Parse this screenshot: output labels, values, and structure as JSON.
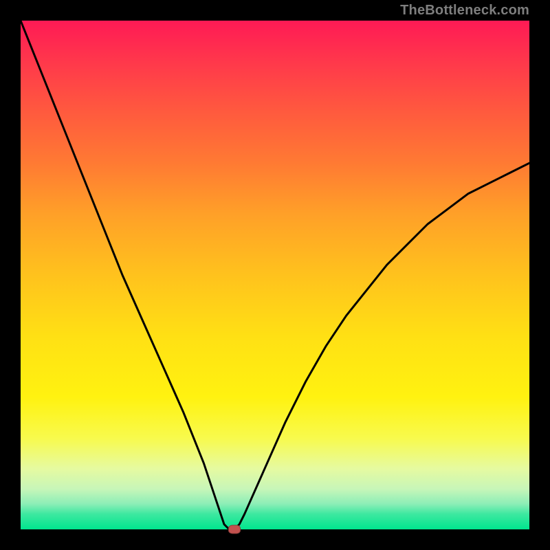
{
  "watermark": "TheBottleneck.com",
  "marker_color": "#c2524f",
  "curve_color": "#000000",
  "curve_width": 3,
  "chart_data": {
    "type": "line",
    "title": "",
    "xlabel": "",
    "ylabel": "",
    "xlim": [
      0,
      100
    ],
    "ylim": [
      0,
      100
    ],
    "grid": false,
    "legend": false,
    "gradient_stops": [
      {
        "pos": 0,
        "color": "#ff1a55"
      },
      {
        "pos": 9,
        "color": "#ff3b4a"
      },
      {
        "pos": 18,
        "color": "#ff5a3e"
      },
      {
        "pos": 28,
        "color": "#ff7a33"
      },
      {
        "pos": 38,
        "color": "#ffa028"
      },
      {
        "pos": 50,
        "color": "#ffc21d"
      },
      {
        "pos": 62,
        "color": "#ffe014"
      },
      {
        "pos": 74,
        "color": "#fff210"
      },
      {
        "pos": 82,
        "color": "#f8fa4c"
      },
      {
        "pos": 88,
        "color": "#e6faa0"
      },
      {
        "pos": 92,
        "color": "#c8f6b8"
      },
      {
        "pos": 95,
        "color": "#8ceeb7"
      },
      {
        "pos": 97,
        "color": "#3de8a0"
      },
      {
        "pos": 100,
        "color": "#00e58e"
      }
    ],
    "series": [
      {
        "name": "bottleneck-curve",
        "x": [
          0,
          4,
          8,
          12,
          16,
          20,
          24,
          28,
          32,
          36,
          38,
          40,
          41,
          42,
          43,
          44,
          48,
          52,
          56,
          60,
          64,
          68,
          72,
          76,
          80,
          84,
          88,
          92,
          96,
          100
        ],
        "y": [
          100,
          90,
          80,
          70,
          60,
          50,
          41,
          32,
          23,
          13,
          7,
          1,
          0,
          0,
          1,
          3,
          12,
          21,
          29,
          36,
          42,
          47,
          52,
          56,
          60,
          63,
          66,
          68,
          70,
          72
        ]
      }
    ],
    "marker": {
      "x": 42,
      "y": 0
    }
  }
}
